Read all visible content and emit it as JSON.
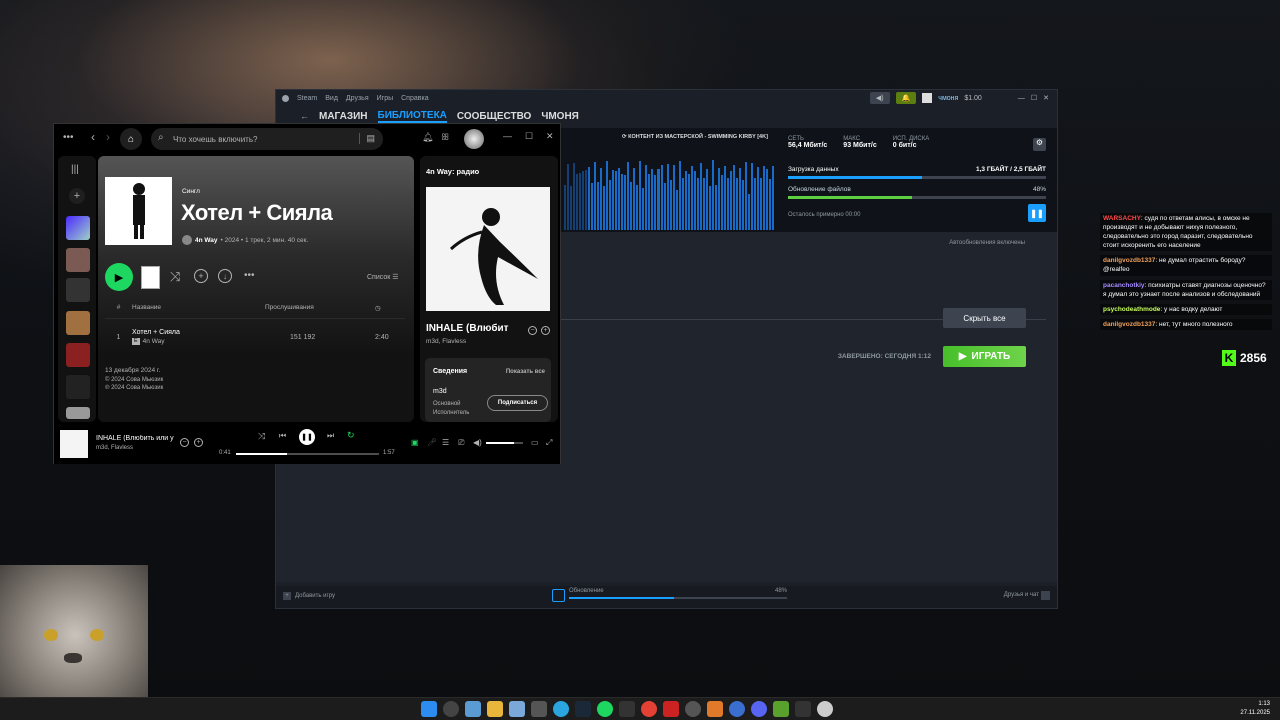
{
  "steam": {
    "menu": [
      "Steam",
      "Вид",
      "Друзья",
      "Игры",
      "Справка"
    ],
    "nav": [
      "МАГАЗИН",
      "БИБЛИОТЕКА",
      "СООБЩЕСТВО",
      "ЧМОНЯ"
    ],
    "user": "чмоня",
    "wallet": "$1.00",
    "workshop": "КОНТЕНТ ИЗ МАСТЕРСКОЙ - SWIMMING KIRBY [4K]",
    "stats": [
      {
        "label": "СЕТЬ",
        "value": "56,4 Мбит/с",
        "color": "#1a9fff"
      },
      {
        "label": "МАКС",
        "value": "93 Мбит/с",
        "color": "#1a9fff"
      },
      {
        "label": "ИСП. ДИСКА",
        "value": "0 бит/с",
        "color": "#5cd040"
      }
    ],
    "download_label": "Загрузка данных",
    "download_value": "1,3 ГБАЙТ / 2,5 ГБАЙТ",
    "download_progress": 0.52,
    "update_label": "Обновление файлов",
    "update_value": "48%",
    "update_progress": 0.48,
    "remaining": "Осталось примерно 00:00",
    "auto_updates": "Автообновления включены",
    "hide_all": "Скрыть все",
    "completed": "ЗАВЕРШЕНО: СЕГОДНЯ 1:12",
    "play": "ИГРАТЬ",
    "add_game": "Добавить игру",
    "footer_update": "Обновление",
    "footer_percent": "48%",
    "footer_progress": 0.48,
    "friends": "Друзья и чат"
  },
  "spotify": {
    "search_placeholder": "Что хочешь включить?",
    "album_type": "Сингл",
    "album_title": "Хотел + Сияла",
    "artist": "4n Way",
    "meta": "• 2024 • 1 трек, 2 мин. 40 сек.",
    "list_label": "Список",
    "col_num": "#",
    "col_title": "Название",
    "col_plays": "Прослушивания",
    "tracks": [
      {
        "num": "1",
        "title": "Хотел + Сияла",
        "explicit": "E",
        "artist": "4n Way",
        "plays": "151 192",
        "duration": "2:40"
      }
    ],
    "release_date": "13 декабря 2024 г.",
    "copyright1": "© 2024 Сова Мьюзик",
    "copyright2": "℗ 2024 Сова Мьюзик",
    "right_title": "4n Way: радио",
    "now_title": "INHALE (Влюбит",
    "now_artists": "m3d, Flavless",
    "details": "Сведения",
    "show_all": "Показать все",
    "artist_card_name": "m3d",
    "artist_role1": "Основной",
    "artist_role2": "Исполнитель",
    "subscribe": "Подписаться",
    "player_title": "INHALE (Влюбить или у",
    "player_artists": "m3d, Flavless",
    "elapsed": "0:41",
    "total": "1:57",
    "progress": 0.36,
    "volume": 0.75
  },
  "chat": [
    {
      "user": "WARSACHY",
      "color": "#ff4a4a",
      "text": "судя по ответам алисы, в омске не производят и не добывают нихуя полезного, следовательно это город паразит, следовательно стоит искоренить его население"
    },
    {
      "user": "danilgvozdb1337",
      "color": "#f0a15c",
      "text": "не думал отрастить бороду? @realfeo"
    },
    {
      "user": "pacanchotkiy",
      "color": "#a58cff",
      "text": "психиатры ставят диагнозы оценочно? я думал это узнает после анализов и обследований"
    },
    {
      "user": "psychodeathmode",
      "color": "#c8ff5c",
      "text": "у нас водку делают"
    },
    {
      "user": "danilgvozdb1337",
      "color": "#f0a15c",
      "text": "нет, тут много полезного"
    }
  ],
  "viewers": "2856",
  "clock": {
    "time": "1:13",
    "date": "27.11.2025"
  }
}
